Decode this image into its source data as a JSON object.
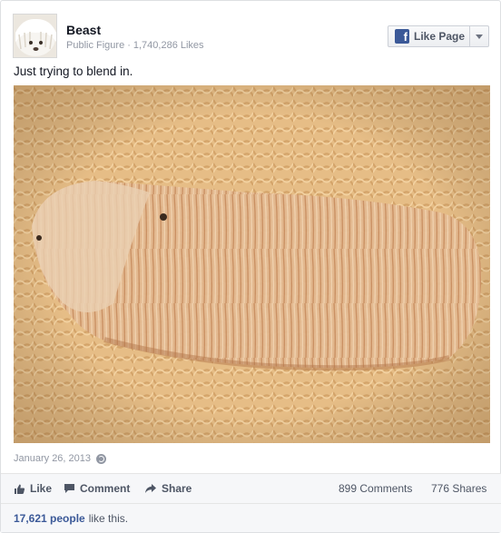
{
  "page": {
    "name": "Beast",
    "category": "Public Figure",
    "likes": "1,740,286 Likes",
    "like_button_label": "Like Page"
  },
  "post": {
    "text": "Just trying to blend in.",
    "timestamp": "January 26, 2013"
  },
  "actions": {
    "like": "Like",
    "comment": "Comment",
    "share": "Share",
    "comments_count": "899 Comments",
    "shares_count": "776 Shares"
  },
  "likes_summary": {
    "count": "17,621 people",
    "suffix": "like this."
  },
  "colors": {
    "facebook_blue": "#3b5998",
    "meta_gray": "#9197a3",
    "text_dark": "#141823"
  },
  "icons": [
    "facebook-logo-icon",
    "chevron-down-icon",
    "globe-icon",
    "thumbs-up-icon",
    "comment-icon",
    "share-arrow-icon"
  ]
}
